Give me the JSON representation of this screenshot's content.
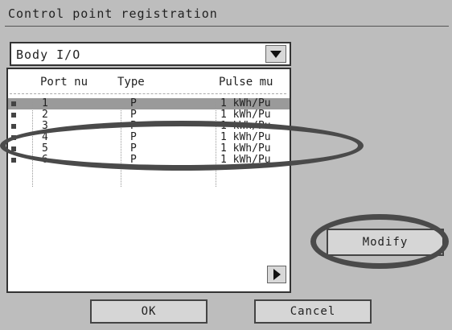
{
  "dialog": {
    "title": "Control point registration"
  },
  "dropdown": {
    "value": "Body I/O",
    "button_icon": "triangle-down-icon"
  },
  "list": {
    "headers": {
      "port": "Port nu",
      "type": "Type",
      "pulse": "Pulse mu"
    },
    "rows": [
      {
        "port": "1",
        "type": "P",
        "pulse": "1 kWh/Pu",
        "selected": true
      },
      {
        "port": "2",
        "type": "P",
        "pulse": "1 kWh/Pu",
        "selected": false
      },
      {
        "port": "3",
        "type": "P",
        "pulse": "1 kWh/Pu",
        "selected": false
      },
      {
        "port": "4",
        "type": "P",
        "pulse": "1 kWh/Pu",
        "selected": false
      },
      {
        "port": "5",
        "type": "P",
        "pulse": "1 kWh/Pu",
        "selected": false
      },
      {
        "port": "6",
        "type": "P",
        "pulse": "1 kWh/Pu",
        "selected": false
      }
    ],
    "scroll_icon": "triangle-right-icon"
  },
  "buttons": {
    "modify": "Modify",
    "ok": "OK",
    "cancel": "Cancel"
  },
  "annotations": {
    "color": "#4a4a4a"
  }
}
